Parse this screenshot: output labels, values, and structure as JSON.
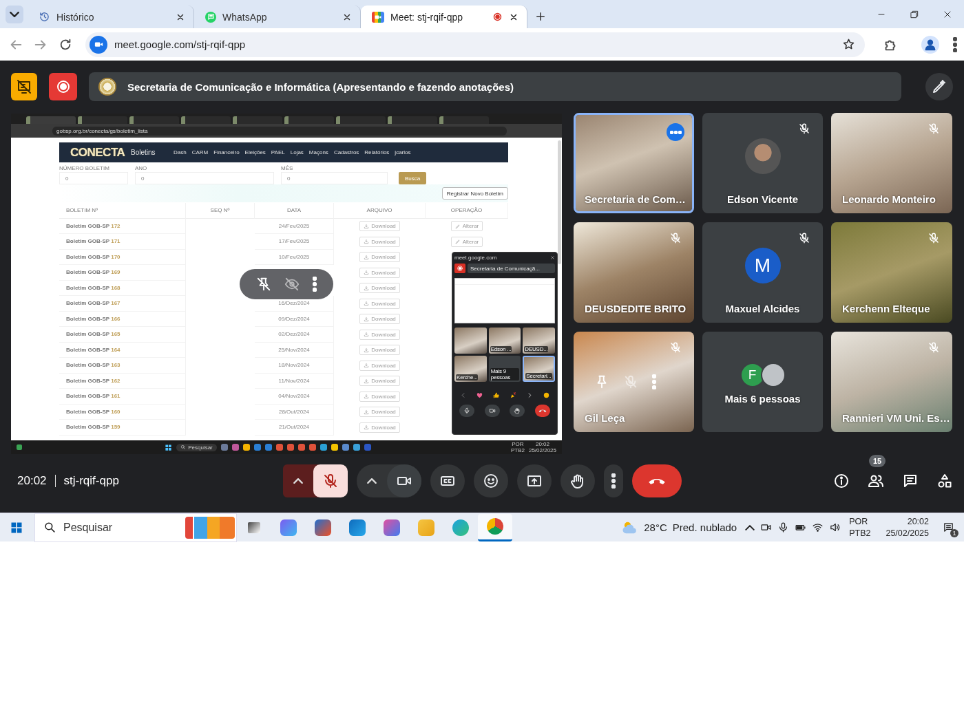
{
  "browser": {
    "tabs": [
      {
        "title": "Histórico",
        "kind": "history",
        "selected": false,
        "recording": false
      },
      {
        "title": "WhatsApp",
        "kind": "messenger",
        "selected": false,
        "recording": false
      },
      {
        "title": "Meet: stj-rqif-qpp",
        "kind": "meet",
        "selected": true,
        "recording": true
      }
    ],
    "url": "meet.google.com/stj-rqif-qpp"
  },
  "meet": {
    "status_buttons": [
      {
        "kind": "presenting"
      },
      {
        "kind": "recording"
      }
    ],
    "banner": "Secretaria de Comunicação e Informática (Apresentando e fazendo anotações)",
    "shared_screen": {
      "url": "gobsp.org.br/conecta/gs/boletim_lista",
      "logo": "CONECTA",
      "section": "Boletins",
      "nav": [
        "Dash",
        "CARM",
        "Financeiro",
        "Eleições",
        "PAEL",
        "Lojas",
        "Maçons",
        "Cadastros",
        "Relatórios",
        "jcarlos"
      ],
      "filters": [
        {
          "label": "NÚMERO BOLETIM",
          "value": "0"
        },
        {
          "label": "ANO",
          "value": "0"
        },
        {
          "label": "MÊS",
          "value": "0"
        }
      ],
      "search_button": "Busca",
      "new_button": "Registrar Novo Boletim",
      "columns": [
        "BOLETIM Nº",
        "SEQ Nº",
        "DATA",
        "ARQUIVO",
        "OPERAÇÃO"
      ],
      "rows": [
        {
          "title": "Boletim GOB-SP",
          "number": "172",
          "date": "24/Fev/2025",
          "file": "Download",
          "operation": "Alterar"
        },
        {
          "title": "Boletim GOB-SP",
          "number": "171",
          "date": "17/Fev/2025",
          "file": "Download",
          "operation": "Alterar"
        },
        {
          "title": "Boletim GOB-SP",
          "number": "170",
          "date": "10/Fev/2025",
          "file": "Download"
        },
        {
          "title": "Boletim GOB-SP",
          "number": "169",
          "file": "Download"
        },
        {
          "title": "Boletim GOB-SP",
          "number": "168",
          "file": "Download"
        },
        {
          "title": "Boletim GOB-SP",
          "number": "167",
          "date": "16/Dez/2024",
          "file": "Download"
        },
        {
          "title": "Boletim GOB-SP",
          "number": "166",
          "date": "09/Dez/2024",
          "file": "Download"
        },
        {
          "title": "Boletim GOB-SP",
          "number": "165",
          "date": "02/Dez/2024",
          "file": "Download"
        },
        {
          "title": "Boletim GOB-SP",
          "number": "164",
          "date": "25/Nov/2024",
          "file": "Download"
        },
        {
          "title": "Boletim GOB-SP",
          "number": "163",
          "date": "18/Nov/2024",
          "file": "Download"
        },
        {
          "title": "Boletim GOB-SP",
          "number": "162",
          "date": "11/Nov/2024",
          "file": "Download"
        },
        {
          "title": "Boletim GOB-SP",
          "number": "161",
          "date": "04/Nov/2024",
          "file": "Download"
        },
        {
          "title": "Boletim GOB-SP",
          "number": "160",
          "date": "28/Out/2024",
          "file": "Download"
        },
        {
          "title": "Boletim GOB-SP",
          "number": "159",
          "date": "21/Out/2024",
          "file": "Download"
        }
      ],
      "pip": {
        "site": "meet.google.com",
        "banner": "Secretaria de Comunicaçã...",
        "tiles": [
          {
            "kind": "video"
          },
          {
            "kind": "video",
            "name": "Edson ..."
          },
          {
            "kind": "video",
            "name": "DEUSD..."
          },
          {
            "kind": "video",
            "name": "Kerche..."
          },
          {
            "kind": "more",
            "name": "Mais 9 pessoas"
          },
          {
            "kind": "video",
            "name": "Secretari...",
            "highlighted": true
          }
        ]
      },
      "taskbar": {
        "search": "Pesquisar",
        "language": "POR",
        "layout": "PTB2",
        "time": "20:02",
        "date": "25/02/2025"
      }
    },
    "participants": [
      {
        "name": "Secretaria de Com…",
        "kind": "video",
        "muted": false,
        "highlighted": true,
        "hovered": false
      },
      {
        "name": "Edson Vicente",
        "kind": "photo-avatar",
        "muted": true,
        "highlighted": false,
        "hovered": false
      },
      {
        "name": "Leonardo Monteiro",
        "kind": "video",
        "muted": true,
        "highlighted": false,
        "hovered": false
      },
      {
        "name": "DEUSDEDITE BRITO",
        "kind": "video",
        "muted": true,
        "highlighted": false,
        "hovered": false
      },
      {
        "name": "Maxuel Alcides",
        "kind": "letter-avatar",
        "initial": "M",
        "color": "#1a5dc8",
        "muted": true,
        "highlighted": false,
        "hovered": false
      },
      {
        "name": "Kerchenn Elteque",
        "kind": "video",
        "muted": true,
        "highlighted": false,
        "hovered": false
      },
      {
        "name": "Gil Leça",
        "kind": "video",
        "muted": true,
        "highlighted": false,
        "hovered": true
      },
      {
        "name": "Mais 6 pessoas",
        "kind": "more",
        "avatars": [
          {
            "kind": "letter",
            "initial": "F",
            "color": "#2e9e4f"
          },
          {
            "kind": "photo"
          }
        ],
        "muted": false,
        "highlighted": false,
        "hovered": false
      },
      {
        "name": "Rannieri VM Uni. Es…",
        "kind": "video",
        "muted": true,
        "highlighted": false,
        "hovered": false
      }
    ],
    "time": "20:02",
    "code": "stj-rqif-qpp",
    "controls": [
      {
        "kind": "mic",
        "on": false
      },
      {
        "kind": "camera",
        "on": true
      },
      {
        "kind": "captions"
      },
      {
        "kind": "reactions"
      },
      {
        "kind": "present"
      },
      {
        "kind": "raise-hand"
      },
      {
        "kind": "more"
      },
      {
        "kind": "leave"
      }
    ],
    "people_count": "15"
  },
  "taskbar": {
    "search": "Pesquisar",
    "apps": [
      {
        "kind": "task-view",
        "selected": false
      },
      {
        "kind": "copilot",
        "selected": false
      },
      {
        "kind": "store",
        "selected": false
      },
      {
        "kind": "mail",
        "selected": false
      },
      {
        "kind": "office",
        "selected": false
      },
      {
        "kind": "folder",
        "selected": false
      },
      {
        "kind": "edge",
        "selected": false
      },
      {
        "kind": "chrome",
        "selected": true
      }
    ],
    "temperature": "28°C",
    "weather": "Pred. nublado",
    "language": "POR",
    "layout": "PTB2",
    "time": "20:02",
    "date": "25/02/2025",
    "notifications": "1"
  }
}
